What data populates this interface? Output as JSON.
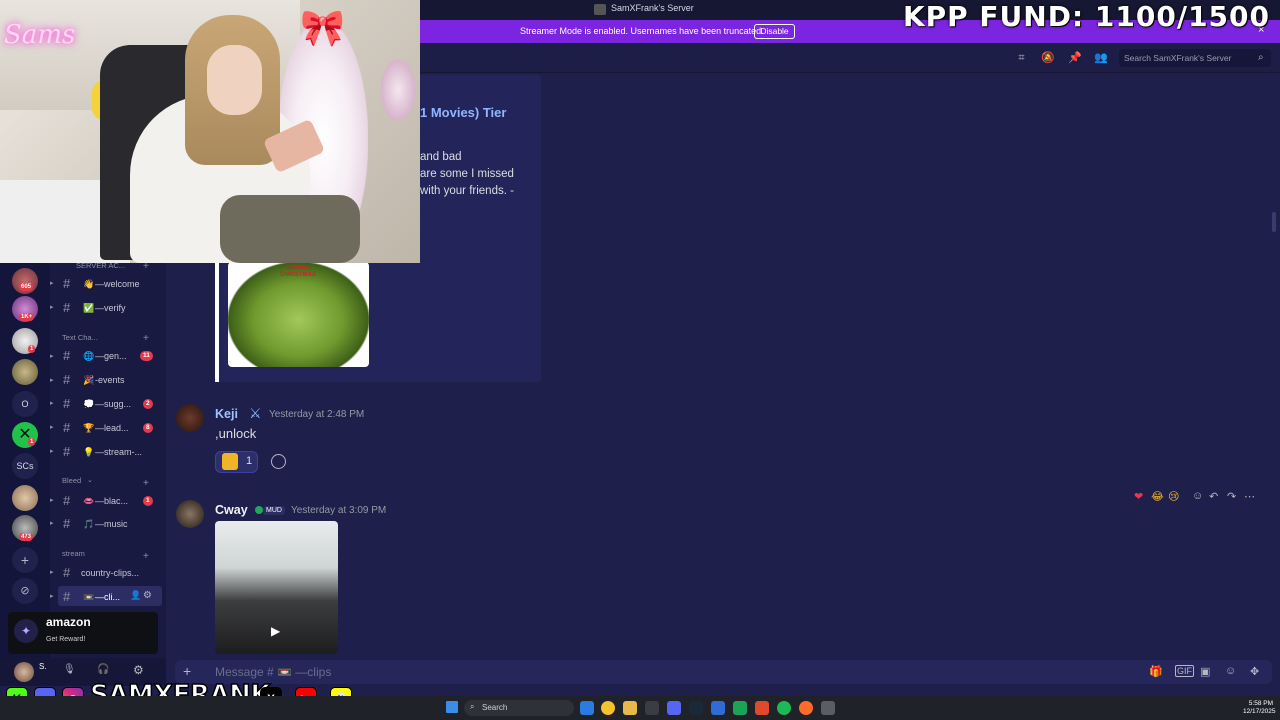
{
  "window": {
    "title": "SamXFrank's Server"
  },
  "overlay": {
    "fund_text": "KPP FUND: 1100/1500",
    "neon_sign": "Sams",
    "brand_handle": "SAMXFRANK"
  },
  "banner": {
    "text": "Streamer Mode is enabled. Usernames have been truncated.",
    "disable_label": "Disable",
    "close_icon": "×"
  },
  "header": {
    "search_placeholder": "Search SamXFrank's Server"
  },
  "servers": [
    {
      "badge": "605"
    },
    {
      "badge": "1K+"
    },
    {
      "badge": "1"
    },
    {
      "badge": ""
    },
    {
      "label": "O"
    },
    {
      "badge": "1"
    },
    {
      "label": "SCs"
    },
    {
      "badge": ""
    },
    {
      "badge": "473"
    }
  ],
  "channels": {
    "categories": {
      "server": "SERVER AC...",
      "text": "Text Cha...",
      "bleed": "Bleed",
      "stream": "stream"
    },
    "items": [
      {
        "emoji": "👋",
        "name": "—welcome",
        "badge": ""
      },
      {
        "emoji": "✅",
        "name": "—verify",
        "badge": ""
      },
      {
        "emoji": "🌐",
        "name": "—gen...",
        "badge": "11"
      },
      {
        "emoji": "🎉",
        "name": "-events",
        "badge": ""
      },
      {
        "emoji": "💭",
        "name": "—sugg...",
        "badge": "2"
      },
      {
        "emoji": "🏆",
        "name": "—lead...",
        "badge": "8"
      },
      {
        "emoji": "💡",
        "name": "—stream-...",
        "badge": ""
      },
      {
        "emoji": "👄",
        "name": "—blac...",
        "badge": "1"
      },
      {
        "emoji": "🎵",
        "name": "—music",
        "badge": ""
      },
      {
        "emoji": "",
        "name": "country-clips...",
        "badge": ""
      },
      {
        "emoji": "📼",
        "name": "—cli...",
        "badge": ""
      }
    ]
  },
  "promo": {
    "title": "amazon",
    "subtitle": "Get Reward!"
  },
  "user_panel": {
    "name": "S."
  },
  "embed": {
    "title": "1 Movies) Tier",
    "lines": [
      "and bad",
      "are some I missed",
      "with your friends. -"
    ],
    "image_text": "GRINCH CHRISTMAS"
  },
  "messages": [
    {
      "author": "Keji",
      "time": "Yesterday at 2:48 PM",
      "text": ",unlock",
      "reaction_count": "1"
    },
    {
      "author": "Cway",
      "badge": "MUD",
      "time": "Yesterday at 3:09 PM",
      "attachment": "video"
    }
  ],
  "composer": {
    "placeholder": "Message # 📼 —clips"
  },
  "taskbar": {
    "search_label": "Search",
    "time": "5:58 PM",
    "date": "12/17/2025"
  },
  "colors": {
    "accent": "#7b25e0",
    "background": "#1e1f4a",
    "badge": "#e23b4b",
    "link": "#8fb6ff"
  }
}
